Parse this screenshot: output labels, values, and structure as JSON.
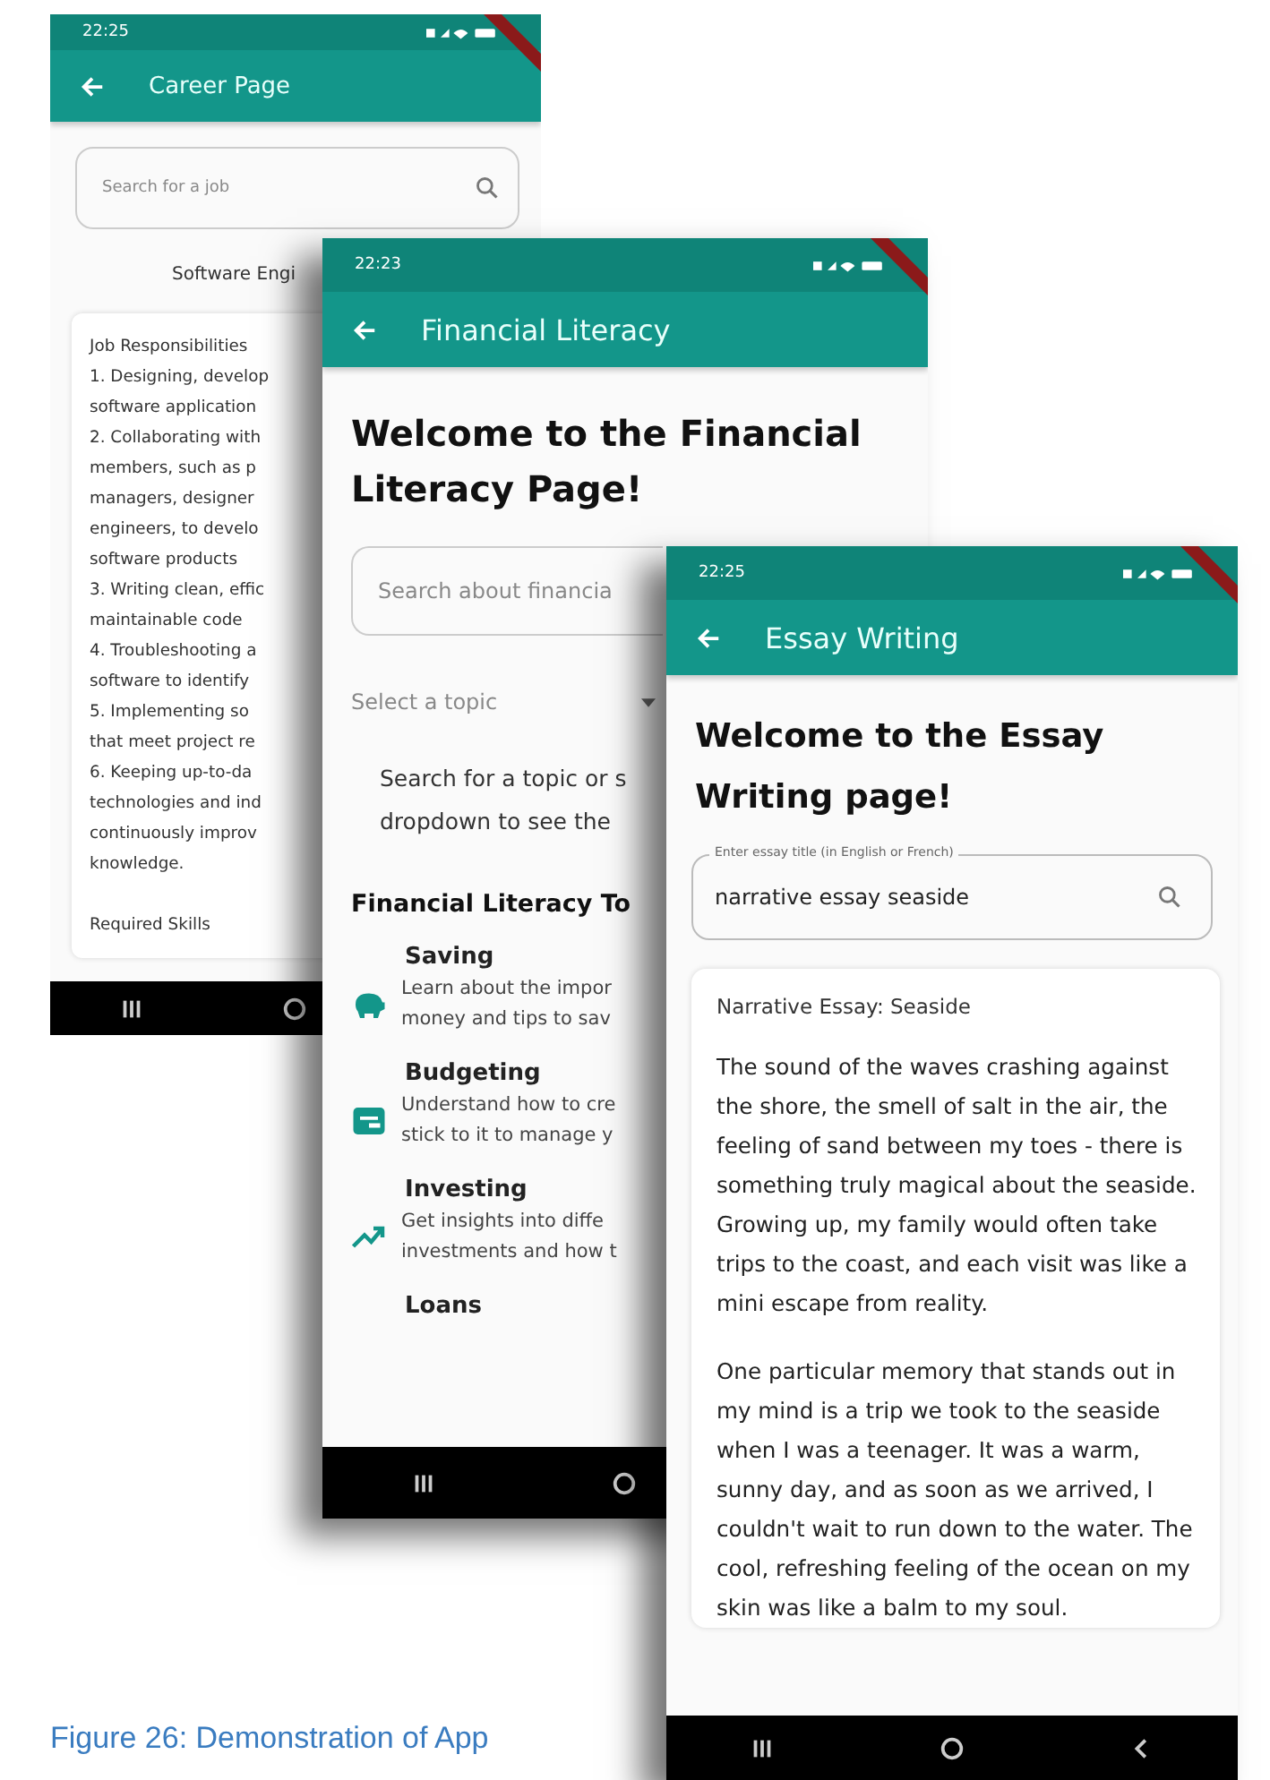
{
  "phones": [
    {
      "kind": "career",
      "status_time": "22:25",
      "title": "Career Page",
      "search": {
        "placeholder": "Search for a job"
      },
      "subtitle": "Software Engi",
      "card_lines": [
        "Job Responsibilities",
        "1. Designing, develop",
        "software application",
        "2. Collaborating with",
        "members, such as p",
        "managers, designer",
        "engineers, to develo",
        "software products",
        "3. Writing clean, effic",
        "maintainable code",
        "4. Troubleshooting a",
        "software to identify",
        "5. Implementing so",
        "that meet project re",
        "6. Keeping up-to-da",
        "technologies and ind",
        "continuously improv",
        "knowledge."
      ],
      "card_footer": "Required Skills",
      "nav_buttons": [
        {
          "kind": "recents"
        },
        {
          "kind": "home"
        }
      ]
    },
    {
      "kind": "finance",
      "status_time": "22:23",
      "title": "Financial Literacy",
      "heading": "Welcome to the Financial Literacy Page!",
      "search": {
        "placeholder": "Search about financia"
      },
      "dropdown": {
        "placeholder": "Select a topic"
      },
      "info_lines": [
        "Search for a topic or s",
        "dropdown to see the"
      ],
      "section_title": "Financial Literacy To",
      "topics": [
        {
          "title": "Saving",
          "lines": [
            "Learn about the impor",
            "money and tips to sav"
          ]
        },
        {
          "title": "Budgeting",
          "lines": [
            "Understand how to cre",
            "stick to it to manage y"
          ]
        },
        {
          "title": "Investing",
          "lines": [
            "Get insights into diffe",
            "investments and how t"
          ]
        },
        {
          "title": "Loans"
        }
      ],
      "nav_buttons": [
        {
          "kind": "recents"
        },
        {
          "kind": "home"
        }
      ]
    },
    {
      "kind": "essay",
      "status_time": "22:25",
      "title": "Essay Writing",
      "heading": "Welcome to the Essay Writing page!",
      "field": {
        "label": "Enter essay title (in English or French)",
        "value": "narrative essay seaside"
      },
      "essay_title": "Narrative Essay: Seaside",
      "paragraphs": [
        "The sound of the waves crashing against the shore, the smell of salt in the air, the feeling of sand between my toes - there is something truly magical about the seaside. Growing up, my family would often take trips to the coast, and each visit was like a mini escape from reality.",
        "One particular memory that stands out in my mind is a trip we took to the seaside when I was a teenager. It was a warm, sunny day, and as soon as we arrived, I couldn't wait to run down to the water. The cool, refreshing feeling of the ocean on my skin was like a balm to my soul."
      ],
      "nav_buttons": [
        {
          "kind": "recents"
        },
        {
          "kind": "home"
        },
        {
          "kind": "back"
        }
      ]
    }
  ],
  "caption": "Figure 26: Demonstration of App"
}
